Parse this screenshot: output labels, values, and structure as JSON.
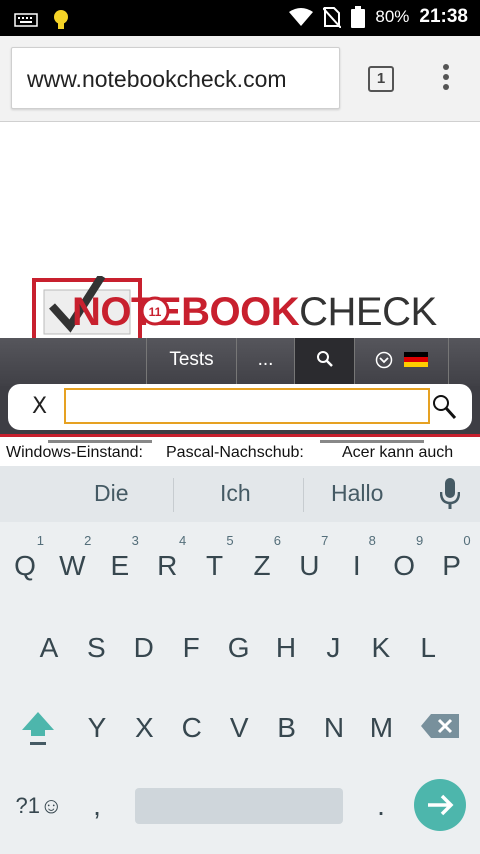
{
  "status_bar": {
    "battery": "80%",
    "time": "21:38"
  },
  "browser": {
    "url": "www.notebookcheck.com",
    "tab_count": "1"
  },
  "site": {
    "logo_part1": "NOTEBOOK",
    "logo_part2": "CHECK",
    "logo_badge": "11",
    "nav": {
      "tests": "Tests",
      "more": "..."
    },
    "search_close": "X",
    "search_value": "",
    "ticker": [
      "Windows-Einstand:",
      "Pascal-Nachschub:",
      "Acer kann auch"
    ]
  },
  "keyboard": {
    "suggestions": [
      "Die",
      "Ich",
      "Hallo"
    ],
    "row1": [
      {
        "k": "Q",
        "h": "1"
      },
      {
        "k": "W",
        "h": "2"
      },
      {
        "k": "E",
        "h": "3"
      },
      {
        "k": "R",
        "h": "4"
      },
      {
        "k": "T",
        "h": "5"
      },
      {
        "k": "Z",
        "h": "6"
      },
      {
        "k": "U",
        "h": "7"
      },
      {
        "k": "I",
        "h": "8"
      },
      {
        "k": "O",
        "h": "9"
      },
      {
        "k": "P",
        "h": "0"
      }
    ],
    "row2": [
      "A",
      "S",
      "D",
      "F",
      "G",
      "H",
      "J",
      "K",
      "L"
    ],
    "row3": [
      "Y",
      "X",
      "C",
      "V",
      "B",
      "N",
      "M"
    ],
    "symbols_key": "?1☺",
    "comma_key": ",",
    "period_key": "."
  },
  "colors": {
    "brand_red": "#c8202e",
    "accent_teal": "#4db6ac",
    "search_border": "#e6a122"
  }
}
